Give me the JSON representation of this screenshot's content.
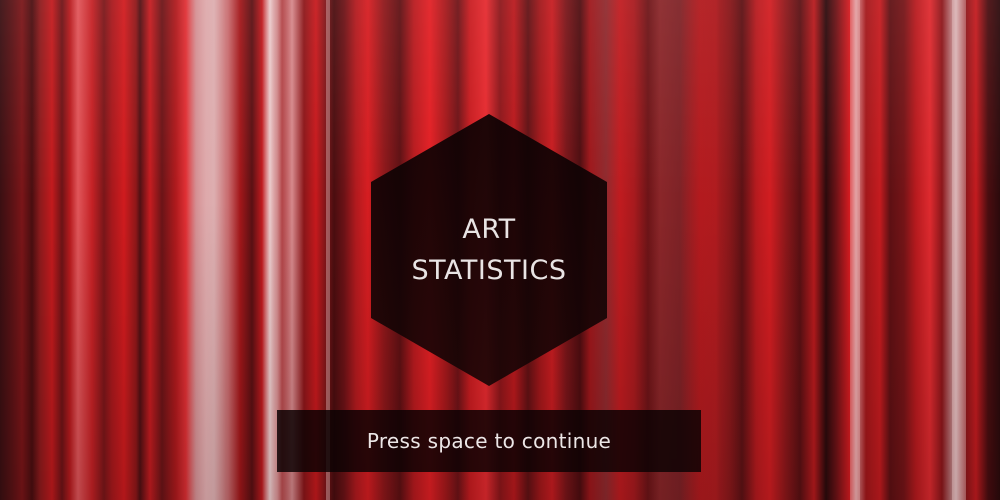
{
  "title": {
    "line1": "ART",
    "line2": "STATISTICS"
  },
  "prompt": {
    "continue_label": "Press space to continue"
  },
  "colors": {
    "background_primary": "#c21a1d",
    "background_dark": "#3a0f12",
    "panel": "#0c0203",
    "text": "#e9e4e4"
  }
}
